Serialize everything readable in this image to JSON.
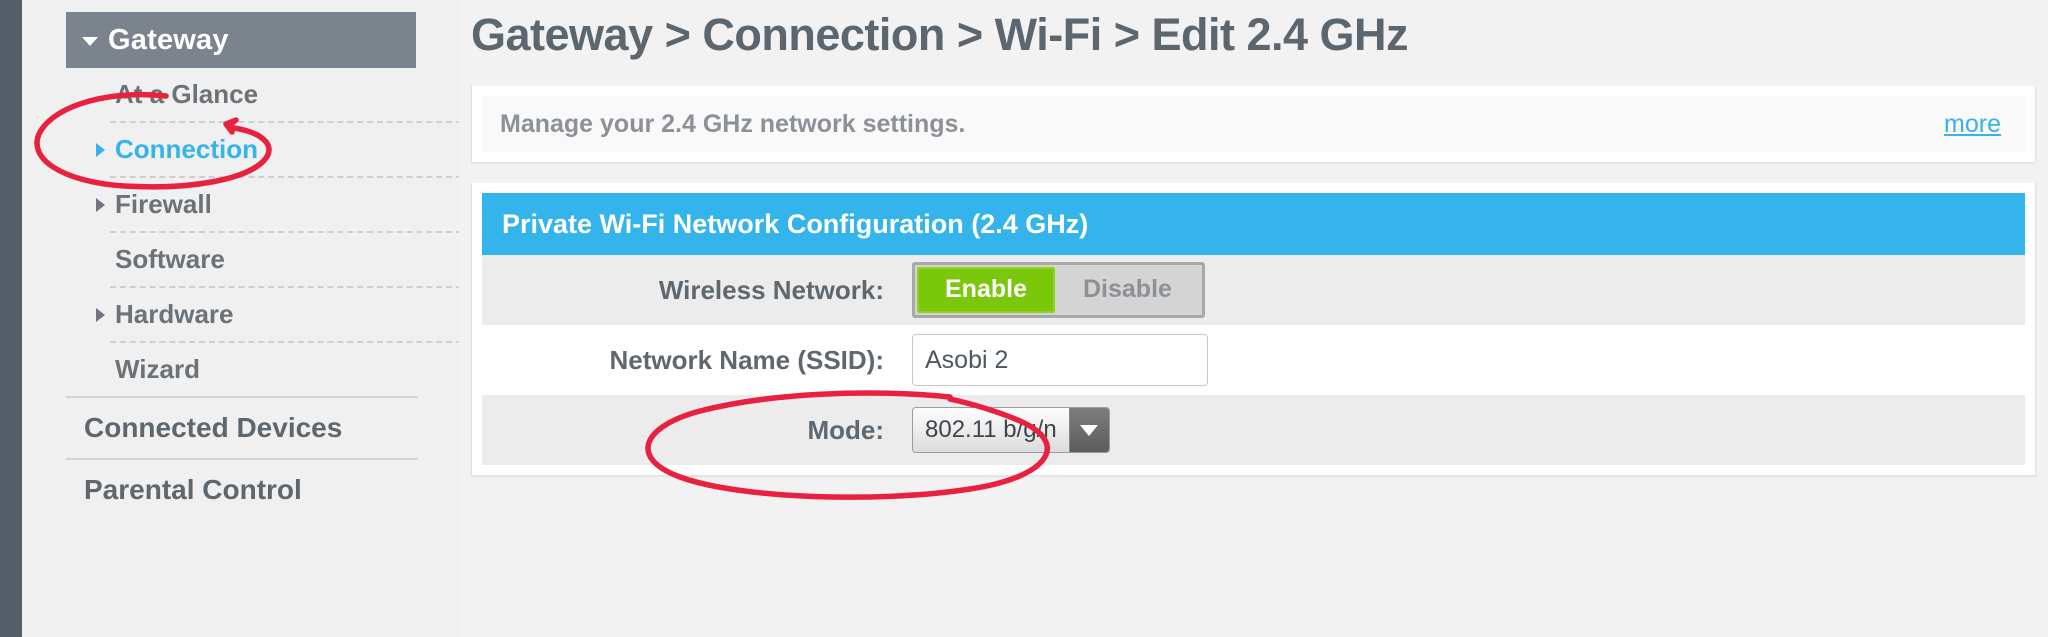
{
  "sidebar": {
    "header": {
      "label": "Gateway",
      "icon": "caret-down-icon"
    },
    "items": [
      {
        "label": "At a Glance",
        "has_caret": false,
        "active": false
      },
      {
        "label": "Connection",
        "has_caret": true,
        "active": true
      },
      {
        "label": "Firewall",
        "has_caret": true,
        "active": false
      },
      {
        "label": "Software",
        "has_caret": false,
        "active": false
      },
      {
        "label": "Hardware",
        "has_caret": true,
        "active": false
      },
      {
        "label": "Wizard",
        "has_caret": false,
        "active": false
      }
    ],
    "groups": [
      {
        "label": "Connected Devices",
        "has_caret": true
      },
      {
        "label": "Parental Control",
        "has_caret": true
      }
    ]
  },
  "main": {
    "title": "Gateway > Connection > Wi-Fi > Edit 2.4 GHz",
    "info": {
      "text": "Manage your 2.4 GHz network settings.",
      "more_label": "more"
    },
    "section": {
      "header": "Private Wi-Fi Network Configuration (2.4 GHz)",
      "rows": [
        {
          "label": "Wireless Network:",
          "type": "toggle",
          "options": [
            "Enable",
            "Disable"
          ],
          "selected": "Enable"
        },
        {
          "label": "Network Name (SSID):",
          "type": "text",
          "value": "Asobi 2",
          "placeholder": ""
        },
        {
          "label": "Mode:",
          "type": "select",
          "value": "802.11 b/g/n",
          "arrow_icon": "chevron-down-icon"
        }
      ]
    }
  },
  "annotations": {
    "color": "#e8213f",
    "items": [
      {
        "name": "connection-circle",
        "target": "Connection"
      },
      {
        "name": "mode-circle",
        "target": "Mode"
      }
    ]
  }
}
